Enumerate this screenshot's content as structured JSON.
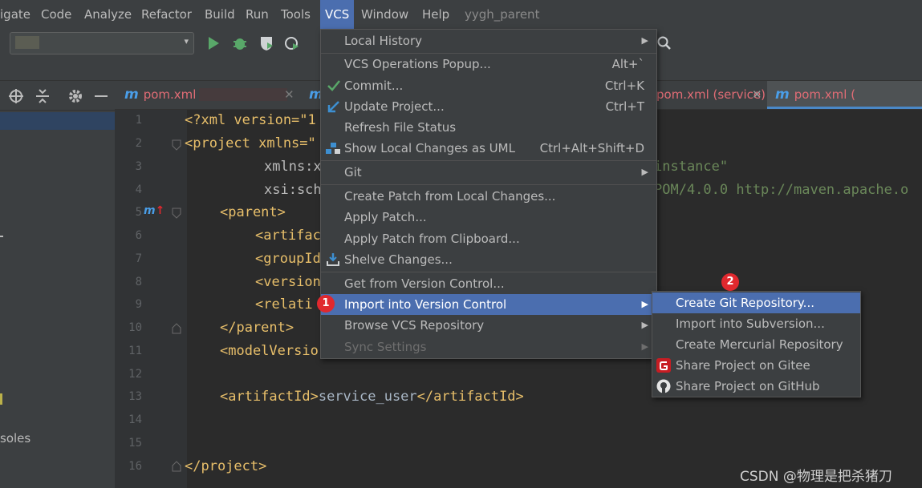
{
  "menubar": {
    "items": [
      "igate",
      "Code",
      "Analyze",
      "Refactor",
      "Build",
      "Run",
      "Tools",
      "VCS",
      "Window",
      "Help",
      "yygh_parent"
    ]
  },
  "tabs": [
    {
      "label": "pom.xml"
    },
    {
      "label": "m"
    },
    {
      "label": "pom.xml (service)"
    },
    {
      "label": "pom.xml ("
    }
  ],
  "editor": {
    "line_numbers": [
      "1",
      "2",
      "3",
      "4",
      "5",
      "6",
      "7",
      "8",
      "9",
      "10",
      "11",
      "12",
      "13",
      "14",
      "15",
      "16"
    ],
    "lines": {
      "l1": "<?xml version=\"1",
      "l2": "<project xmlns=\"",
      "l3": "xmlns:x",
      "l3r": "instance\"",
      "l4": "xsi:sch",
      "l4r": "POM/4.0.0 http://maven.apache.o",
      "l5": "<parent>",
      "l6": "<artifac",
      "l7": "<groupId",
      "l8": "<version",
      "l9": "<relati",
      "l10": "</parent>",
      "l11": "<modelVersio",
      "l13a": "<artifactId>",
      "l13b": "service_user",
      "l13c": "</artifactId>",
      "l16": "</project>"
    }
  },
  "left_panel": {
    "labels": [
      "soles"
    ]
  },
  "vcs_menu": {
    "items": [
      {
        "label": "Local History",
        "shortcut": "",
        "submenu": true
      },
      {
        "label": "VCS Operations Popup...",
        "shortcut": "Alt+`"
      },
      {
        "label": "Commit...",
        "shortcut": "Ctrl+K"
      },
      {
        "label": "Update Project...",
        "shortcut": "Ctrl+T"
      },
      {
        "label": "Refresh File Status",
        "shortcut": ""
      },
      {
        "label": "Show Local Changes as UML",
        "shortcut": "Ctrl+Alt+Shift+D"
      },
      {
        "label": "Git",
        "shortcut": "",
        "submenu": true
      },
      {
        "label": "Create Patch from Local Changes...",
        "shortcut": ""
      },
      {
        "label": "Apply Patch...",
        "shortcut": ""
      },
      {
        "label": "Apply Patch from Clipboard...",
        "shortcut": ""
      },
      {
        "label": "Shelve Changes...",
        "shortcut": ""
      },
      {
        "label": "Get from Version Control...",
        "shortcut": ""
      },
      {
        "label": "Import into Version Control",
        "shortcut": "",
        "submenu": true
      },
      {
        "label": "Browse VCS Repository",
        "shortcut": "",
        "submenu": true
      },
      {
        "label": "Sync Settings",
        "shortcut": "",
        "submenu": true
      }
    ]
  },
  "import_submenu": {
    "items": [
      {
        "label": "Create Git Repository..."
      },
      {
        "label": "Import into Subversion..."
      },
      {
        "label": "Create Mercurial Repository"
      },
      {
        "label": "Share Project on Gitee"
      },
      {
        "label": "Share Project on GitHub"
      }
    ]
  },
  "badges": [
    "1",
    "2"
  ],
  "watermark": "CSDN @物理是把杀猪刀",
  "colors": {
    "accent": "#4b6eaf",
    "badge": "#e0282e",
    "tag": "#e8bf6a",
    "string": "#6a8759"
  },
  "icons": [
    "run-icon",
    "debug-icon",
    "coverage-icon",
    "profile-icon",
    "search-icon",
    "target-icon",
    "collapse-icon",
    "gear-icon",
    "minimize-icon",
    "check-icon",
    "update-arrow-icon",
    "uml-icon",
    "shelve-icon",
    "gitee-icon",
    "github-icon"
  ]
}
